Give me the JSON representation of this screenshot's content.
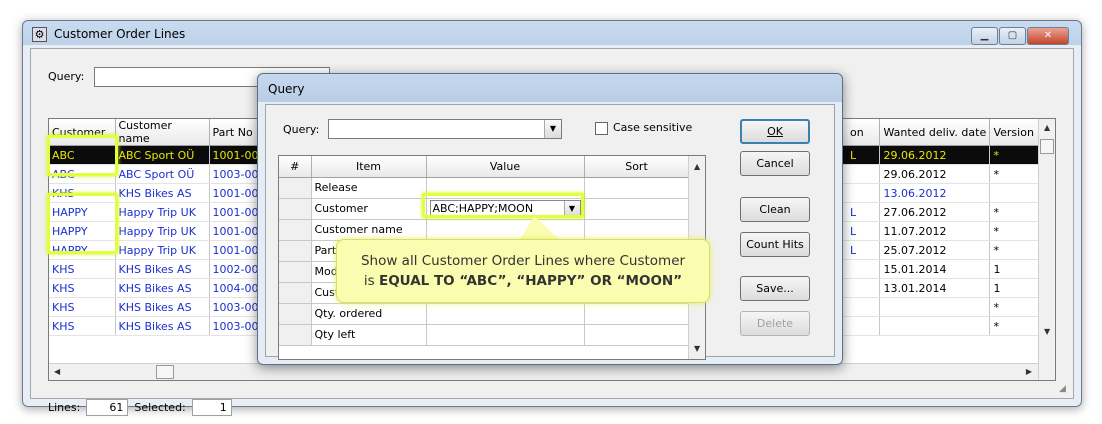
{
  "window": {
    "title": "Customer Order Lines",
    "query_label": "Query:",
    "query_value": ""
  },
  "grid": {
    "columns_left": [
      "Customer",
      "Customer name",
      "Part No"
    ],
    "columns_right": [
      "on",
      "Wanted deliv. date",
      "Version"
    ],
    "rows": [
      {
        "customer": "ABC",
        "name": "ABC Sport OÜ",
        "part": "1001-00",
        "flag": "L",
        "date": "29.06.2012",
        "version": "*"
      },
      {
        "customer": "ABC",
        "name": "ABC Sport OÜ",
        "part": "1003-00",
        "flag": "",
        "date": "29.06.2012",
        "version": "*"
      },
      {
        "customer": "KHS",
        "name": "KHS Bikes AS",
        "part": "1001-00",
        "flag": "",
        "date": "13.06.2012",
        "version": ""
      },
      {
        "customer": "HAPPY",
        "name": "Happy Trip UK",
        "part": "1001-00",
        "flag": "L",
        "date": "27.06.2012",
        "version": "*"
      },
      {
        "customer": "HAPPY",
        "name": "Happy Trip UK",
        "part": "1001-00",
        "flag": "L",
        "date": "11.07.2012",
        "version": "*"
      },
      {
        "customer": "HAPPY",
        "name": "Happy Trip UK",
        "part": "1001-00",
        "flag": "L",
        "date": "25.07.2012",
        "version": "*"
      },
      {
        "customer": "KHS",
        "name": "KHS Bikes AS",
        "part": "1002-00",
        "flag": "",
        "date": "15.01.2014",
        "version": "1"
      },
      {
        "customer": "KHS",
        "name": "KHS Bikes AS",
        "part": "1004-00",
        "flag": "",
        "date": "13.01.2014",
        "version": "1"
      },
      {
        "customer": "KHS",
        "name": "KHS Bikes AS",
        "part": "1003-00",
        "flag": "",
        "date": "",
        "version": "*"
      },
      {
        "customer": "KHS",
        "name": "KHS Bikes AS",
        "part": "1003-00",
        "flag": "",
        "date": "",
        "version": "*"
      }
    ]
  },
  "status": {
    "lines_label": "Lines:",
    "lines_value": "61",
    "selected_label": "Selected:",
    "selected_value": "1"
  },
  "dialog": {
    "title": "Query",
    "query_label": "Query:",
    "query_value": "",
    "case_sensitive_label": "Case sensitive",
    "case_sensitive_checked": false,
    "columns": [
      "#",
      "Item",
      "Value",
      "Sort"
    ],
    "rows": [
      {
        "item": "Release",
        "value": "",
        "sort": ""
      },
      {
        "item": "Customer",
        "value": "ABC;HAPPY;MOON",
        "sort": ""
      },
      {
        "item": "Customer name",
        "value": "",
        "sort": ""
      },
      {
        "item": "Part",
        "value": "",
        "sort": ""
      },
      {
        "item": "Mod",
        "value": "",
        "sort": ""
      },
      {
        "item": "Cust",
        "value": "",
        "sort": ""
      },
      {
        "item": "Qty. ordered",
        "value": "",
        "sort": ""
      },
      {
        "item": "Qty left",
        "value": "",
        "sort": ""
      }
    ],
    "buttons": {
      "ok": "OK",
      "cancel": "Cancel",
      "clean": "Clean",
      "count_hits": "Count Hits",
      "save": "Save...",
      "delete": "Delete"
    }
  },
  "callout": {
    "line1": "Show all Customer Order Lines where Customer",
    "line2_prefix": "is ",
    "line2_bold1": "EQUAL TO “ABC”, “HAPPY”",
    "line2_mid": " OR “",
    "line2_bold2": "MOON",
    "line2_end": "”"
  },
  "colors": {
    "highlight": "#e3ff3a",
    "link_text": "#1a2fd0",
    "selected_row_bg": "#0b0b0b",
    "selected_row_text": "#e8e800",
    "callout_bg": "#fafcb0"
  }
}
